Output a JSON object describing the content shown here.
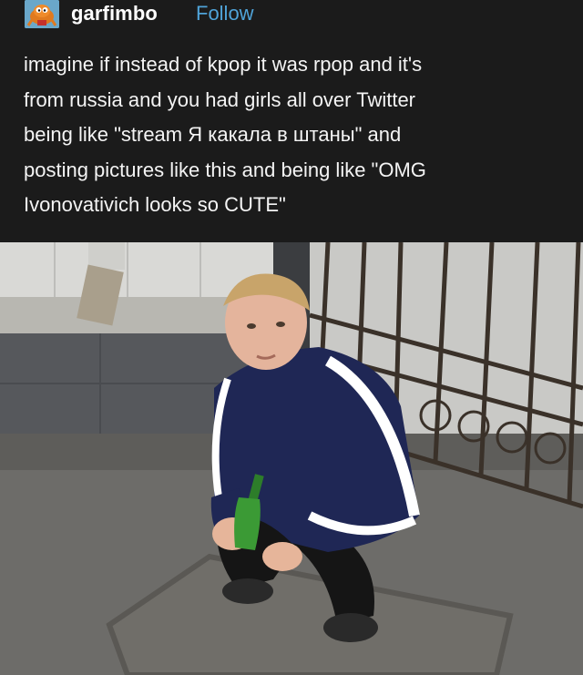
{
  "post": {
    "username": "garfimbo",
    "follow_label": "Follow",
    "text": "imagine if instead of kpop it was rpop and it's\nfrom russia and you had girls all over Twitter\nbeing like \"stream Я какала в штаны\" and\nposting pictures like this and being like \"OMG\nIvonovativich looks so CUTE\"",
    "avatar_icon": "garfield-avatar-icon",
    "image_name": "photo-of-young-man-squatting-with-bottle"
  },
  "colors": {
    "background": "#1b1b1b",
    "follow": "#4fa3d8",
    "text": "#f4f4f4"
  }
}
